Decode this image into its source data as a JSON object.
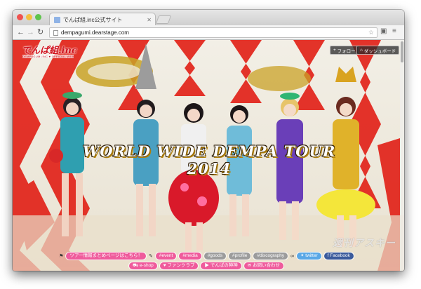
{
  "browser": {
    "tab_title": "でんぱ組.inc公式サイト",
    "url": "dempagumi.dearstage.com"
  },
  "site": {
    "logo_text": "でんぱ組.inc",
    "logo_subtitle": "DEMPAGUMI.INC ♥ OFFICIAL WEB",
    "follow_label": "フォロー",
    "dashboard_label": "ダッシュボード",
    "hero_title": "WORLD WIDE DEMPA TOUR 2014"
  },
  "nav": {
    "tour_link": "ツアー情報まとめページはこちら！",
    "tags": [
      "#event",
      "#media",
      "#goods",
      "#profile",
      "#discography"
    ],
    "twitter_label": "twitter",
    "facebook_label": "Facebook",
    "eshop_label": "e-shop",
    "fanclub_label": "ファンクラブ",
    "shrine_label": "でんぱの神神",
    "contact_label": "お問い合わせ"
  },
  "colors": {
    "accent_pink": "#ef5b9c",
    "tag_gray": "#9c9c9c",
    "twitter_blue": "#5aa8e6",
    "facebook_blue": "#3b5b9c"
  },
  "watermark": "週刊アスキー"
}
